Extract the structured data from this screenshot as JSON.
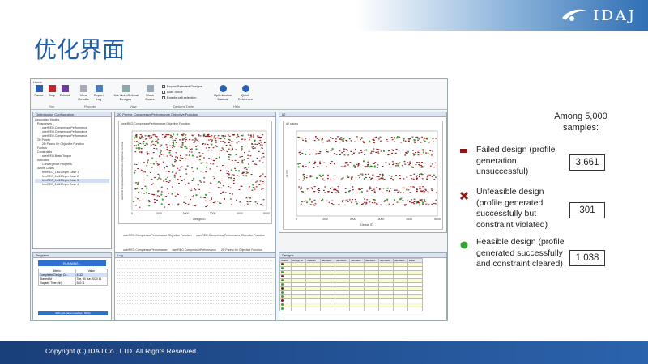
{
  "header": {
    "logo_text": "IDAJ",
    "page_title": "优化界面"
  },
  "footer": {
    "copyright": "Copyright (C) IDAJ Co., LTD. All Rights Reserved."
  },
  "app": {
    "ribbon": {
      "tab": "Home",
      "buttons": [
        "Pause",
        "Stop",
        "Extend",
        "View Results",
        "Export Log",
        "Hide Non-Optimal Designs",
        "Show Cases",
        "Optimization Manual",
        "Quick Reference"
      ],
      "groups": [
        "Run",
        "Reports",
        "View",
        "Designs Table",
        "Help"
      ],
      "checks": [
        "Export Selected Designs",
        "Auto Scroll",
        "Enable cell selection"
      ]
    },
    "config": {
      "title": "Optimization Configuration",
      "items": [
        "Associated Models",
        "Responses",
        "userREO.CompressorPerformance",
        "userREO.CompressorPerformance",
        "userREO.CompressorPerformance",
        "2D Pareto",
        "2D Pareto for Objective Function",
        "Factors",
        "Constraints",
        "userREO.BrakeTorque",
        "Activities",
        "Convergence Progress",
        "Active Cases",
        "femREO_1st150rpm Case 1",
        "femREO_1st150rpm Case 2",
        "femREO_1st150rpm Case 3",
        "femREO_1st150rpm Case 4"
      ]
    },
    "plot1": {
      "tab": "2D Pareto: CompressorPerformance Objective Function",
      "title": "userREO.CompressorPerformance Objective Function",
      "ylabel": "userREO.CompressorPerformance Objective Function",
      "xlabel": "Design ID",
      "xticks": [
        "0",
        "1000",
        "2000",
        "3000",
        "4000",
        "5000"
      ]
    },
    "plot1_legend": [
      "userREO.CompressorPerformance Objective Function",
      "userREO.CompressorPerformance Objective Function",
      "userREO.CompressorPerformance",
      "userREO.CompressorPerformance",
      "2D Pareto for Objective Function",
      "Convergence Progress"
    ],
    "plot2": {
      "tab": "#2",
      "title": "#2 values",
      "ylabel": "#2 (%)",
      "xlabel": "Design ID",
      "xticks": [
        "0",
        "1000",
        "2000",
        "3000",
        "4000",
        "5000"
      ]
    },
    "progress": {
      "title": "Progress",
      "status": "RUNNING...",
      "col_metric": "Metric",
      "col_value": "Value",
      "rows": [
        [
          "Completed Design Ca...",
          "4112"
        ],
        [
          "Started At",
          "Tue, 30 Jun 2020 11"
        ],
        [
          "Elapsed Time (hh)",
          "540:11"
        ]
      ],
      "bar_text": "82% (est. target reached : 5000)"
    },
    "log": {
      "title": "Log"
    },
    "designs": {
      "title": "Designs",
      "columns": [
        "Status",
        "Design ID",
        "Case ID",
        "userREO...",
        "userREO...",
        "userREO...",
        "userREO...",
        "userREO...",
        "userREO...",
        "Betal"
      ]
    }
  },
  "legend": {
    "among": "Among 5,000 samples:",
    "items": [
      {
        "label": "Failed design (profile generation unsuccessful)",
        "count": "3,661",
        "color": "#8b1a1a"
      },
      {
        "label": "Unfeasible design (profile generated successfully but constraint violated)",
        "count": "301",
        "color": "#8b1a1a"
      },
      {
        "label": "Feasible design (profile generated successfully and constraint cleared)",
        "count": "1,038",
        "color": "#3aa335"
      }
    ]
  }
}
